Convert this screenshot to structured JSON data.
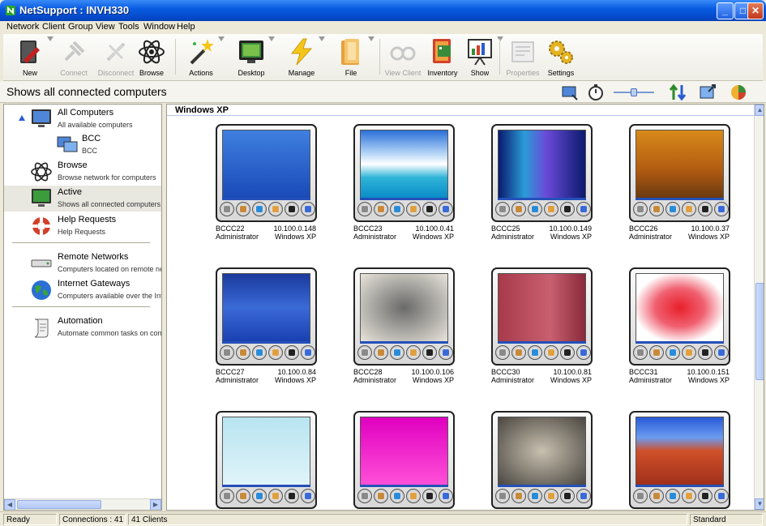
{
  "window": {
    "title": "NetSupport : INVH330",
    "controls": [
      "minimize-icon",
      "maximize-icon",
      "close-icon"
    ]
  },
  "menu": [
    "Network",
    "Client",
    "Group",
    "View",
    "Tools",
    "Window",
    "Help"
  ],
  "toolbar": [
    {
      "label": "New",
      "icon": "new-book-icon",
      "enabled": true
    },
    {
      "label": "Connect",
      "icon": "connect-plug-icon",
      "enabled": false
    },
    {
      "label": "Disconnect",
      "icon": "disconnect-plug-icon",
      "enabled": false
    },
    {
      "label": "Browse",
      "icon": "atom-icon",
      "enabled": true
    },
    {
      "label": "Actions",
      "icon": "magic-wand-icon",
      "enabled": true
    },
    {
      "label": "Desktop",
      "icon": "monitor-icon",
      "enabled": true
    },
    {
      "label": "Manage",
      "icon": "lightning-icon",
      "enabled": true
    },
    {
      "label": "File",
      "icon": "folder-icon",
      "enabled": true
    },
    {
      "label": "View Client",
      "icon": "glasses-icon",
      "enabled": false
    },
    {
      "label": "Inventory",
      "icon": "inventory-book-icon",
      "enabled": true
    },
    {
      "label": "Show",
      "icon": "presentation-icon",
      "enabled": true
    },
    {
      "label": "Properties",
      "icon": "properties-icon",
      "enabled": false
    },
    {
      "label": "Settings",
      "icon": "gears-icon",
      "enabled": true
    }
  ],
  "info_strip": {
    "title": "Shows all connected computers",
    "view_icons": [
      "view-mode-icon",
      "timer-icon",
      "zoom-slider",
      "sort-icon",
      "scale-icon",
      "color-icon"
    ]
  },
  "nav": {
    "all_computers": {
      "label": "All Computers",
      "sub": "All available computers"
    },
    "bcc": {
      "label": "BCC",
      "sub": "BCC"
    },
    "browse": {
      "label": "Browse",
      "sub": "Browse network for computers"
    },
    "active": {
      "label": "Active",
      "sub": "Shows all connected computers"
    },
    "help_requests": {
      "label": "Help Requests",
      "sub": "Help Requests"
    },
    "remote_networks": {
      "label": "Remote Networks",
      "sub": "Computers located on remote net"
    },
    "internet_gateways": {
      "label": "Internet Gateways",
      "sub": "Computers available over the Inte"
    },
    "automation": {
      "label": "Automation",
      "sub": "Automate common tasks on comp"
    }
  },
  "group": {
    "title": "Windows XP"
  },
  "clients": [
    {
      "name": "BCCC22",
      "user": "Administrator",
      "ip": "10.100.0.148",
      "os": "Windows XP",
      "wallpaper": "fish"
    },
    {
      "name": "BCCC23",
      "user": "Administrator",
      "ip": "10.100.0.41",
      "os": "Windows XP",
      "wallpaper": "beach"
    },
    {
      "name": "BCCC25",
      "user": "Administrator",
      "ip": "10.100.0.149",
      "os": "Windows XP",
      "wallpaper": "aurora"
    },
    {
      "name": "BCCC26",
      "user": "Administrator",
      "ip": "10.100.0.37",
      "os": "Windows XP",
      "wallpaper": "autumn"
    },
    {
      "name": "BCCC27",
      "user": "Administrator",
      "ip": "10.100.0.84",
      "os": "Windows XP",
      "wallpaper": "mountain"
    },
    {
      "name": "BCCC28",
      "user": "Administrator",
      "ip": "10.100.0.106",
      "os": "Windows XP",
      "wallpaper": "sepia"
    },
    {
      "name": "BCCC30",
      "user": "Administrator",
      "ip": "10.100.0.81",
      "os": "Windows XP",
      "wallpaper": "redwall"
    },
    {
      "name": "BCCC31",
      "user": "Administrator",
      "ip": "10.100.0.151",
      "os": "Windows XP",
      "wallpaper": "redswirl"
    },
    {
      "name": "",
      "user": "",
      "ip": "",
      "os": "",
      "wallpaper": "paleblue"
    },
    {
      "name": "",
      "user": "",
      "ip": "",
      "os": "",
      "wallpaper": "magenta"
    },
    {
      "name": "",
      "user": "",
      "ip": "",
      "os": "",
      "wallpaper": "moon"
    },
    {
      "name": "",
      "user": "",
      "ip": "",
      "os": "",
      "wallpaper": "desert"
    }
  ],
  "status": {
    "ready": "Ready",
    "connections": "Connections : 41",
    "clients": "41 Clients",
    "mode": "Standard"
  },
  "colors": {
    "titlebar": "#0a5de3",
    "selected_nav": "#e8e7e0",
    "group_line": "#b6c6e4"
  }
}
